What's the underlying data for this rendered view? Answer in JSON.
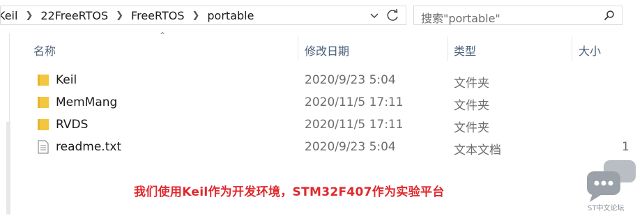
{
  "address_bar": {
    "breadcrumbs": [
      "Keil",
      "22FreeRTOS",
      "FreeRTOS",
      "portable"
    ]
  },
  "search": {
    "placeholder": "搜索\"portable\""
  },
  "columns": {
    "name": "名称",
    "date": "修改日期",
    "type": "类型",
    "size": "大小"
  },
  "files": [
    {
      "name": "Keil",
      "date": "2020/9/23 5:04",
      "type": "文件夹",
      "size": "",
      "icon": "folder-icon"
    },
    {
      "name": "MemMang",
      "date": "2020/11/5 17:11",
      "type": "文件夹",
      "size": "",
      "icon": "folder-icon"
    },
    {
      "name": "RVDS",
      "date": "2020/11/5 17:11",
      "type": "文件夹",
      "size": "",
      "icon": "folder-icon"
    },
    {
      "name": "readme.txt",
      "date": "2020/9/23 5:04",
      "type": "文本文档",
      "size": "1",
      "icon": "text-file-icon"
    }
  ],
  "caption": "我们使用Keil作为开发环境，STM32F407作为实验平台",
  "watermark": {
    "text": "ST中文论坛"
  },
  "colors": {
    "caption": "#e0282d",
    "folder": "#f3c63f",
    "header_text": "#4c607a"
  }
}
